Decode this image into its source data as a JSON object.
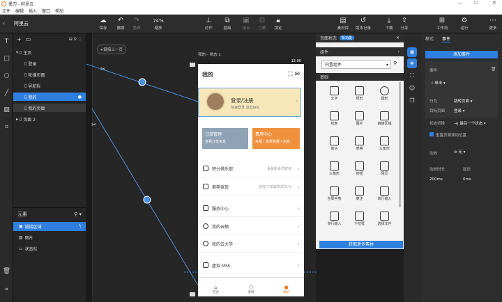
{
  "window": {
    "title": "墨刀 - 阿里云",
    "min": "—",
    "max": "☐",
    "close": "✕"
  },
  "menu": [
    "文件",
    "编辑",
    "插入",
    "窗口",
    "帮助"
  ],
  "toolbar": {
    "project": "阿里云",
    "items": [
      {
        "label": "保存",
        "icon": "save-icon"
      },
      {
        "label": "撤销",
        "icon": "undo-icon"
      },
      {
        "label": "重做",
        "icon": "redo-icon"
      },
      {
        "label": "74%",
        "icon": "zoom-icon"
      },
      {
        "label": "缩放",
        "icon": "zoom-icon"
      },
      {
        "label": "对齐",
        "icon": "align-icon"
      },
      {
        "label": "层级",
        "icon": "layer-icon"
      },
      {
        "label": "组合",
        "icon": "group-icon"
      },
      {
        "label": "打散",
        "icon": "ungroup-icon"
      },
      {
        "label": "锁定",
        "icon": "lock-icon"
      },
      {
        "label": "素材库",
        "icon": "library-icon"
      },
      {
        "label": "版本记录",
        "icon": "history-icon"
      },
      {
        "label": "下载",
        "icon": "download-icon"
      },
      {
        "label": "分享",
        "icon": "share-icon"
      },
      {
        "label": "工作流",
        "icon": "workflow-icon"
      },
      {
        "label": "运行",
        "icon": "run-icon"
      },
      {
        "label": "更多",
        "icon": "more-icon"
      }
    ]
  },
  "pages": {
    "items": [
      {
        "label": "主页"
      },
      {
        "label": "登录"
      },
      {
        "label": "轮播页面"
      },
      {
        "label": "导航栏"
      },
      {
        "label": "我的"
      },
      {
        "label": "我的页面"
      },
      {
        "label": "页面 2"
      }
    ]
  },
  "elements": {
    "title": "元素",
    "items": [
      {
        "label": "链接区域"
      },
      {
        "label": "图片"
      },
      {
        "label": "状态栏"
      }
    ]
  },
  "canvas": {
    "back_label": "◂ 链接上一页",
    "artboard_label": "我的 - 状态 1"
  },
  "phone": {
    "time": "12:00",
    "title": "我的",
    "login_title": "登录/注册",
    "login_sub": "快速登录 送抵好礼",
    "card1_title": "订单管理",
    "card1_sub": "查看订单信息",
    "card2_title": "费用中心",
    "card2_sub": "余额 / 发票管理 / 充值",
    "items": [
      {
        "label": "积分俱乐部",
        "right": "看最新会员权益"
      },
      {
        "label": "推荐返现",
        "right": "好友下单最高返31%"
      },
      {
        "label": "服务中心",
        "right": ""
      },
      {
        "label": "我的云栖",
        "right": ""
      },
      {
        "label": "我的云大学",
        "right": ""
      },
      {
        "label": "虚拟 MFA",
        "right": ""
      }
    ],
    "tabs": [
      "首页",
      "发现",
      "我的"
    ]
  },
  "widgets": {
    "title": "页面状态",
    "badge": "新功能",
    "section1": "组件",
    "dropdown": "内置组件",
    "section2": "基础",
    "items": [
      "文字",
      "矩形",
      "圆形",
      "线条",
      "图片",
      "链接区域",
      "箭头",
      "表格",
      "三角形",
      "三角形",
      "按钮",
      "网页",
      "全局手势",
      "菜注",
      "单行输入",
      "多行输入",
      "下拉框",
      "选择文件"
    ],
    "get_more": "获取更多素材"
  },
  "props": {
    "tabs": [
      "样式",
      "事件"
    ],
    "add_event": "添加事件",
    "event_label": "事件",
    "event_value": "单击",
    "action_label": "行为",
    "action_value": "跳转页面",
    "target_label": "目标页面",
    "target_value": "登录",
    "switch_label": "状态切换",
    "switch_value": "→| 最后一个状态",
    "keep_scroll": "重置页面滚动位置",
    "anim_label": "动效",
    "anim_value": "无",
    "duration_label": "动效时长",
    "delay_label": "延迟",
    "duration_value": "200ms",
    "delay_value": "0ms"
  }
}
